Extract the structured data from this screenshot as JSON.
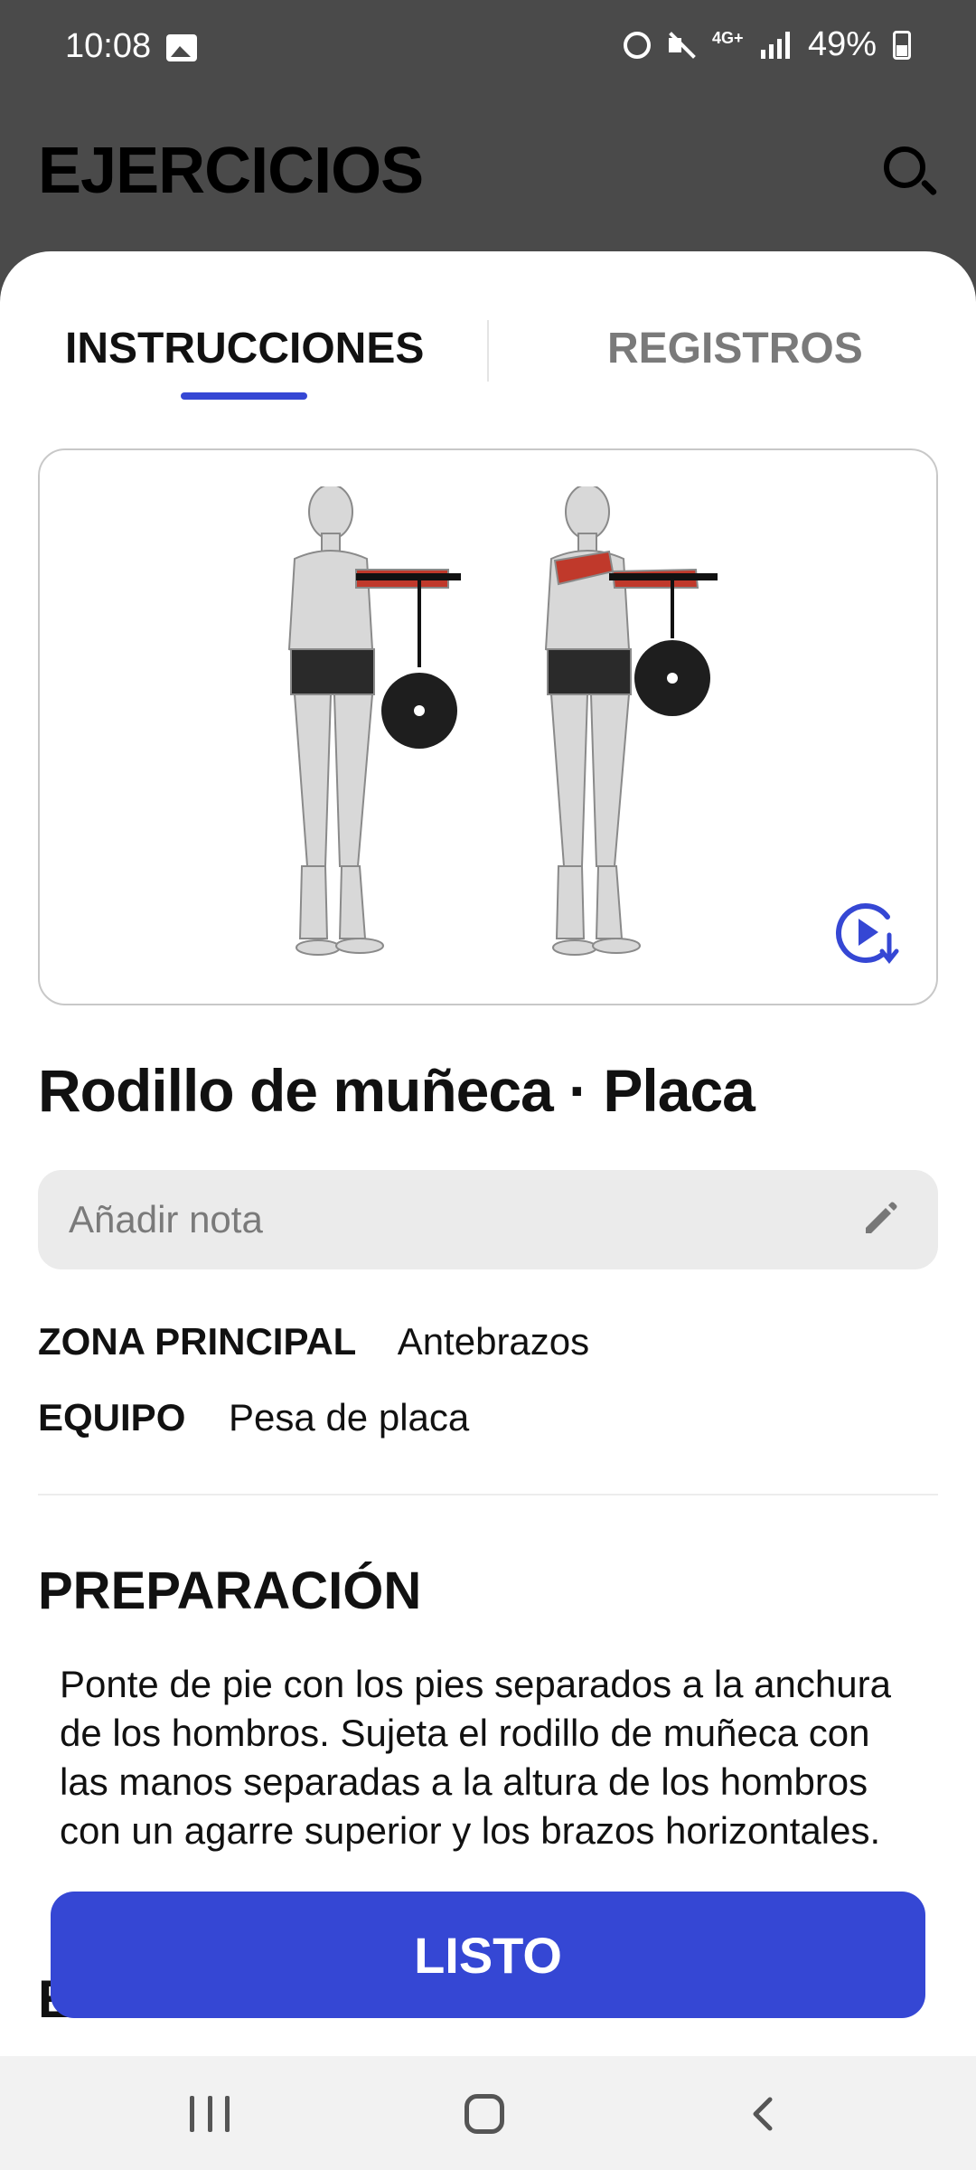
{
  "status": {
    "time": "10:08",
    "battery": "49%",
    "network": "4G+"
  },
  "header": {
    "title": "EJERCICIOS"
  },
  "tabs": [
    {
      "label": "INSTRUCCIONES",
      "active": true
    },
    {
      "label": "REGISTROS",
      "active": false
    }
  ],
  "exercise": {
    "title": "Rodillo de muñeca · Placa",
    "note_placeholder": "Añadir nota",
    "zona_label": "ZONA PRINCIPAL",
    "zona_value": "Antebrazos",
    "equipo_label": "EQUIPO",
    "equipo_value": "Pesa de placa"
  },
  "preparation": {
    "title": "PREPARACIÓN",
    "text": "Ponte de pie con los pies separados a la anchura de los hombros. Sujeta el rodillo de muñeca con las manos separadas a la altura de los hombros con un agarre superior y los brazos horizontales."
  },
  "next_section": {
    "title": "EJECUCIÓN"
  },
  "done_button": "LISTO",
  "colors": {
    "accent": "#3547d4",
    "header_bg": "#4a4a4a",
    "muscle": "#c0392b"
  }
}
